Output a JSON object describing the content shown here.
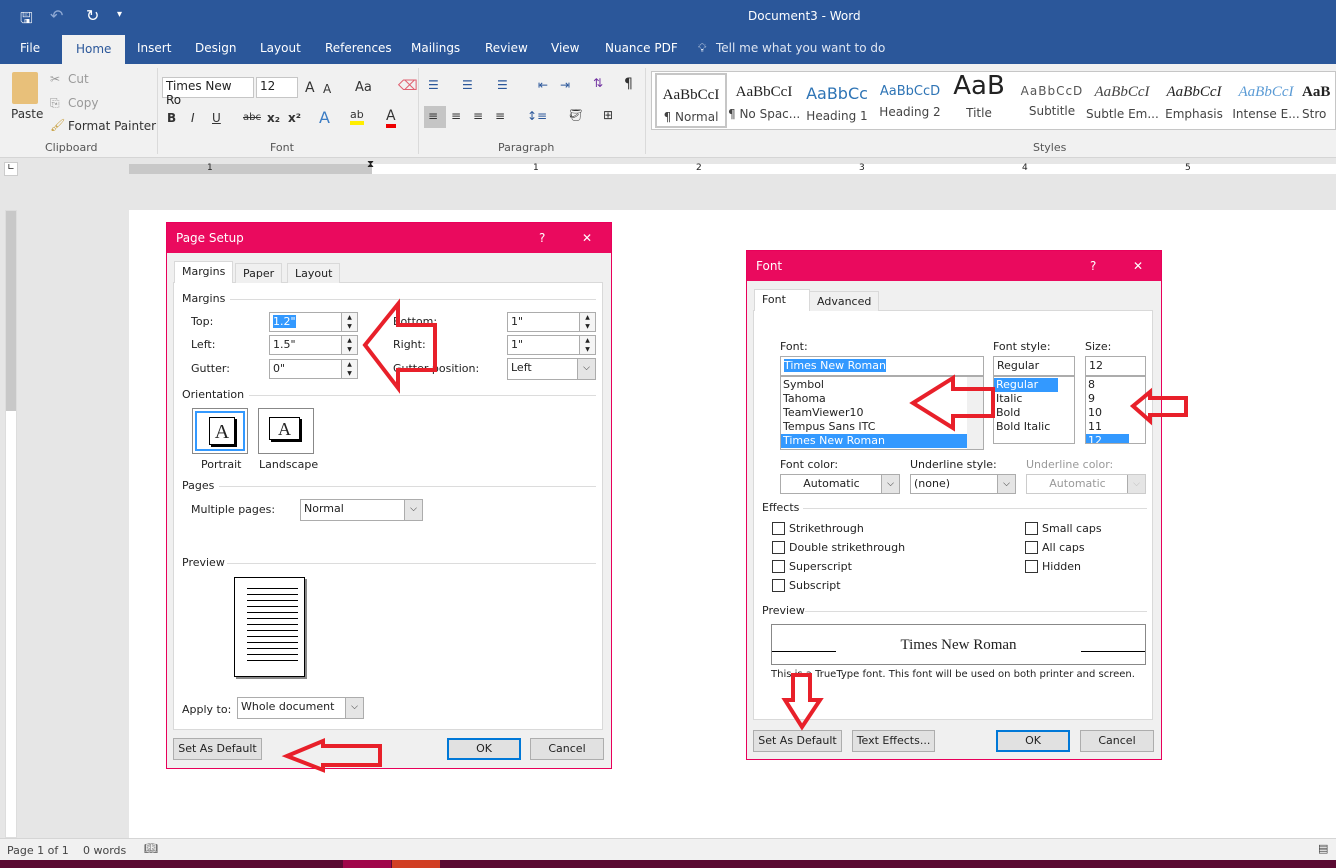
{
  "window": {
    "title": "Document3 - Word"
  },
  "qat": {
    "save": "save-icon",
    "undo": "undo-icon",
    "redo": "redo-icon",
    "customize": "▾"
  },
  "tabs": [
    "File",
    "Home",
    "Insert",
    "Design",
    "Layout",
    "References",
    "Mailings",
    "Review",
    "View",
    "Nuance PDF"
  ],
  "tell_me": "Tell me what you want to do",
  "ribbon": {
    "clipboard": {
      "label": "Clipboard",
      "paste": "Paste",
      "cut": "Cut",
      "copy": "Copy",
      "format_painter": "Format Painter"
    },
    "font": {
      "label": "Font",
      "font_name": "Times New Ro",
      "font_size": "12",
      "bold": "B",
      "italic": "I",
      "underline": "U",
      "strike": "abc",
      "sub": "x₂",
      "sup": "x²",
      "grow": "A",
      "shrink": "A",
      "case": "Aa"
    },
    "paragraph": {
      "label": "Paragraph"
    },
    "styles": {
      "label": "Styles",
      "items": [
        {
          "sample": "AaBbCcI",
          "name": "¶ Normal"
        },
        {
          "sample": "AaBbCcI",
          "name": "¶ No Spac..."
        },
        {
          "sample": "AaBbCc",
          "name": "Heading 1"
        },
        {
          "sample": "AaBbCcD",
          "name": "Heading 2"
        },
        {
          "sample": "AaB",
          "name": "Title"
        },
        {
          "sample": "AaBbCcD",
          "name": "Subtitle"
        },
        {
          "sample": "AaBbCcI",
          "name": "Subtle Em..."
        },
        {
          "sample": "AaBbCcI",
          "name": "Emphasis"
        },
        {
          "sample": "AaBbCcI",
          "name": "Intense E..."
        },
        {
          "sample": "AaB",
          "name": "Stro"
        }
      ]
    }
  },
  "ruler": {
    "labels": [
      "1",
      "1",
      "2",
      "3",
      "4",
      "5"
    ]
  },
  "page_setup": {
    "title": "Page Setup",
    "help": "?",
    "close": "✕",
    "tabs": [
      "Margins",
      "Paper",
      "Layout"
    ],
    "margins_label": "Margins",
    "top_label": "Top:",
    "top": "1.2\"",
    "bottom_label": "Bottom:",
    "bottom": "1\"",
    "left_label": "Left:",
    "left": "1.5\"",
    "right_label": "Right:",
    "right": "1\"",
    "gutter_label": "Gutter:",
    "gutter": "0\"",
    "gutter_pos_label": "Gutter position:",
    "gutter_pos": "Left",
    "orientation_label": "Orientation",
    "portrait": "Portrait",
    "landscape": "Landscape",
    "orient_glyph": "A",
    "pages_label": "Pages",
    "multiple_pages_label": "Multiple pages:",
    "multiple_pages": "Normal",
    "preview_label": "Preview",
    "apply_to_label": "Apply to:",
    "apply_to": "Whole document",
    "set_default": "Set As Default",
    "ok": "OK",
    "cancel": "Cancel"
  },
  "font_dialog": {
    "title": "Font",
    "help": "?",
    "close": "✕",
    "tabs": [
      "Font",
      "Advanced"
    ],
    "font_label": "Font:",
    "font_value": "Times New Roman",
    "font_list": [
      "Symbol",
      "Tahoma",
      "TeamViewer10",
      "Tempus Sans ITC",
      "Times New Roman"
    ],
    "style_label": "Font style:",
    "style_value": "Regular",
    "style_list": [
      "Regular",
      "Italic",
      "Bold",
      "Bold Italic"
    ],
    "size_label": "Size:",
    "size_value": "12",
    "size_list": [
      "8",
      "9",
      "10",
      "11",
      "12"
    ],
    "font_color_label": "Font color:",
    "font_color": "Automatic",
    "underline_style_label": "Underline style:",
    "underline_style": "(none)",
    "underline_color_label": "Underline color:",
    "underline_color": "Automatic",
    "effects_label": "Effects",
    "effects_left": [
      "Strikethrough",
      "Double strikethrough",
      "Superscript",
      "Subscript"
    ],
    "effects_right": [
      "Small caps",
      "All caps",
      "Hidden"
    ],
    "preview_label": "Preview",
    "preview_text": "Times New Roman",
    "note": "This is a TrueType font. This font will be used on both printer and screen.",
    "set_default": "Set As Default",
    "text_effects": "Text Effects...",
    "ok": "OK",
    "cancel": "Cancel"
  },
  "status": {
    "page": "Page 1 of 1",
    "words": "0 words"
  },
  "colors": {
    "title_bar": "#2b579a",
    "dialog_title": "#ea0a5e",
    "annotation_arrow": "#e8202a",
    "selection": "#3399ff"
  }
}
